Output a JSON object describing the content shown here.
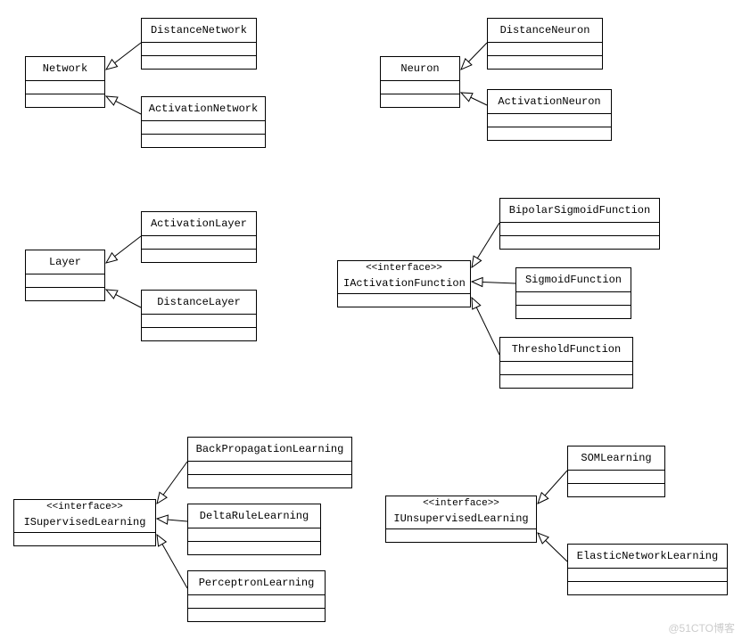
{
  "watermark": "@51CTO博客",
  "classes": {
    "network": {
      "name": "Network"
    },
    "distanceNetwork": {
      "name": "DistanceNetwork"
    },
    "activationNetwork": {
      "name": "ActivationNetwork"
    },
    "neuron": {
      "name": "Neuron"
    },
    "distanceNeuron": {
      "name": "DistanceNeuron"
    },
    "activationNeuron": {
      "name": "ActivationNeuron"
    },
    "layer": {
      "name": "Layer"
    },
    "activationLayer": {
      "name": "ActivationLayer"
    },
    "distanceLayer": {
      "name": "DistanceLayer"
    },
    "iActivationFunction": {
      "stereo": "<<interface>>",
      "name": "IActivationFunction"
    },
    "bipolarSigmoid": {
      "name": "BipolarSigmoidFunction"
    },
    "sigmoid": {
      "name": "SigmoidFunction"
    },
    "threshold": {
      "name": "ThresholdFunction"
    },
    "iSupervised": {
      "stereo": "<<interface>>",
      "name": "ISupervisedLearning"
    },
    "backProp": {
      "name": "BackPropagationLearning"
    },
    "deltaRule": {
      "name": "DeltaRuleLearning"
    },
    "perceptron": {
      "name": "PerceptronLearning"
    },
    "iUnsupervised": {
      "stereo": "<<interface>>",
      "name": "IUnsupervisedLearning"
    },
    "som": {
      "name": "SOMLearning"
    },
    "elastic": {
      "name": "ElasticNetworkLearning"
    }
  }
}
